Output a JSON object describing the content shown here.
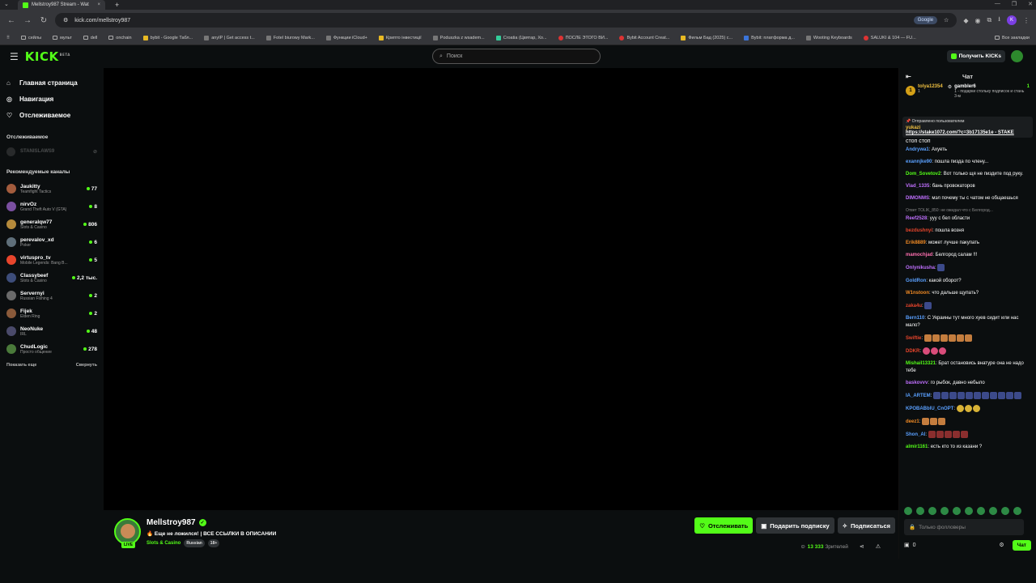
{
  "browser": {
    "tab_title": "Mellstroy987 Stream - Wat",
    "url": "kick.com/mellstroy987",
    "google_label": "Google",
    "bookmarks": [
      "сейлы",
      "мульт",
      "dell",
      "onchain",
      "bybit - Google Табл...",
      "anyIP | Get access t...",
      "Fotel biurowy Mark...",
      "Функции iCloud+",
      "Крипто інвестиції",
      "Poduszka z wsadem...",
      "Croatia (Цвятар, Хо...",
      "ПОСЛЕ ЭТОГО ВИ...",
      "Bybit Account Creat...",
      "Фильм Бад (2025) с...",
      "Bybit: платформа д...",
      "Wooting Keyboards",
      "SALUKI & 104 — FU..."
    ],
    "bookmarks_all": "Все закладки"
  },
  "header": {
    "logo": "KICK",
    "logo_badge": "BETA",
    "search_placeholder": "Поиск",
    "get_kicks": "Получить KICKs"
  },
  "sidebar": {
    "nav": [
      {
        "label": "Главная страница",
        "icon": "home-icon"
      },
      {
        "label": "Навигация",
        "icon": "compass-icon"
      },
      {
        "label": "Отслеживаемое",
        "icon": "heart-icon"
      }
    ],
    "followed_title": "Отслеживаемое",
    "followed": [
      {
        "name": "STANISLAWS9"
      }
    ],
    "recommended_title": "Рекомендуемые каналы",
    "channels": [
      {
        "name": "Jaukitty",
        "category": "Teamfight Tactics",
        "viewers": "77",
        "color": "#a35c3d"
      },
      {
        "name": "nirvOz",
        "category": "Grand Theft Auto V (GTA)",
        "viewers": "8",
        "color": "#7a4fa0"
      },
      {
        "name": "generalqw77",
        "category": "Slots & Casino",
        "viewers": "806",
        "color": "#b58a3b"
      },
      {
        "name": "perevalov_xd",
        "category": "Poker",
        "viewers": "6",
        "color": "#5f6f7a"
      },
      {
        "name": "virtuspro_tv",
        "category": "Mobile Legends: Bang B...",
        "viewers": "5",
        "color": "#e8452c"
      },
      {
        "name": "Classybeef",
        "category": "Slots & Casino",
        "viewers": "2,2 тыс.",
        "color": "#3d4d7a"
      },
      {
        "name": "Servernyi",
        "category": "Russian Fishing 4",
        "viewers": "2",
        "color": "#6a6a6a"
      },
      {
        "name": "Fijek",
        "category": "Elden Ring",
        "viewers": "2",
        "color": "#8a5a3a"
      },
      {
        "name": "NeoNuke",
        "category": "IRL",
        "viewers": "48",
        "color": "#4a4a6a"
      },
      {
        "name": "ChudLogic",
        "category": "Просто общение",
        "viewers": "278",
        "color": "#4a7a3a"
      }
    ],
    "show_more": "Показать еще",
    "collapse": "Свернуть"
  },
  "stream": {
    "streamer": "Mellstroy987",
    "live": "LIVE",
    "title": "🔥 Еще не ложился! | ВСЕ ССЫЛКИ В ОПИСАНИИ",
    "category": "Slots & Casino",
    "tags": [
      "Russian",
      "18+"
    ],
    "follow": "Отслеживать",
    "gift_sub": "Подарить подписку",
    "subscribe": "Подписаться",
    "viewers_count": "13 333",
    "viewers_label": "Зрителей"
  },
  "chat": {
    "title": "Чат",
    "leaderboard": [
      {
        "rank": "1",
        "name": "tolya12354",
        "count": "1"
      },
      {
        "name": "gambler6",
        "count": "1",
        "note": "1 - подарки стольку подписок и стань 3-м"
      }
    ],
    "pinned_label": "Отправлено пользователем",
    "pinned_user": "yukazi",
    "pinned_text": "https://stake1072.com/?c=3b17135e1e - STAKE",
    "stop_text": "стоп стоп",
    "messages": [
      {
        "user": "Andrywa1",
        "color": "#5aa0ff",
        "text": ": Ахуеть"
      },
      {
        "user": "exannjke90",
        "color": "#5aa0ff",
        "text": ": пошла пизда по члену..."
      },
      {
        "user": "Dom_Sovetov2",
        "color": "#53fc18",
        "text": ": Вот только щя не пиздите под руку."
      },
      {
        "user": "Vlad_1335",
        "color": "#c070ff",
        "text": ": бань провокаторов"
      },
      {
        "user": "DIMONMS",
        "color": "#c070ff",
        "text": ": мэл почему ты с чатом не общаешься"
      },
      {
        "reply": "Ответ TOLIK_850: не ожидал что с Белгород..."
      },
      {
        "user": "Reef2528",
        "color": "#c070ff",
        "text": ": ууу с бел области"
      },
      {
        "user": "bezdushnyi",
        "color": "#e8452c",
        "text": ": пошла возня"
      },
      {
        "user": "Erik8889",
        "color": "#f08a24",
        "text": ": может лучше пакупать"
      },
      {
        "user": "mamochjad",
        "color": "#ff70b0",
        "text": ": Белгород салам !!!"
      },
      {
        "user": "Onlynikusha",
        "color": "#c070ff",
        "text": ":",
        "emotes": [
          "g"
        ]
      },
      {
        "user": "GoldRon",
        "color": "#5aa0ff",
        "text": ": какой оборот?"
      },
      {
        "user": "W1nstoon",
        "color": "#f08a24",
        "text": ": что дальше щупать?"
      },
      {
        "user": "zaka4u",
        "color": "#e8452c",
        "text": ":",
        "emotes": [
          "g"
        ]
      },
      {
        "user": "Bern110",
        "color": "#5aa0ff",
        "text": ": С Украины тут много хуев сидит или нас мало?"
      },
      {
        "user": "Swiftie",
        "color": "#e8452c",
        "text": ":",
        "emotes": [
          "o",
          "o",
          "o",
          "o",
          "o",
          "o"
        ]
      },
      {
        "user": "DDKR",
        "color": "#e8452c",
        "text": ":",
        "emotes": [
          "p",
          "p",
          "p"
        ]
      },
      {
        "user": "Mishail13321",
        "color": "#53fc18",
        "text": ": Брат остановись внатуре она не надо тебе"
      },
      {
        "user": "baskovvv",
        "color": "#c070ff",
        "text": ": го рыбок, давно небыло"
      },
      {
        "user": "IA_ARTEM",
        "color": "#5aa0ff",
        "text": ":",
        "emotes": [
          "g",
          "g",
          "g",
          "g",
          "g",
          "g",
          "g",
          "g",
          "g",
          "g",
          "g"
        ]
      },
      {
        "user": "KPOBABblU_CnOPT",
        "color": "#5aa0ff",
        "text": ":",
        "emotes": [
          "y",
          "y",
          "y"
        ]
      },
      {
        "user": "deez1",
        "color": "#f08a24",
        "text": ":",
        "emotes": [
          "o",
          "o",
          "o"
        ]
      },
      {
        "user": "Shon_Al",
        "color": "#5aa0ff",
        "text": ":",
        "emotes": [
          "r",
          "r",
          "r",
          "r",
          "r"
        ]
      },
      {
        "user": "almir1161",
        "color": "#53fc18",
        "text": ": есть кто то из казани ?"
      }
    ],
    "input_placeholder": "Только фолловеры",
    "kicks_count": "0",
    "chat_button": "Чат"
  }
}
